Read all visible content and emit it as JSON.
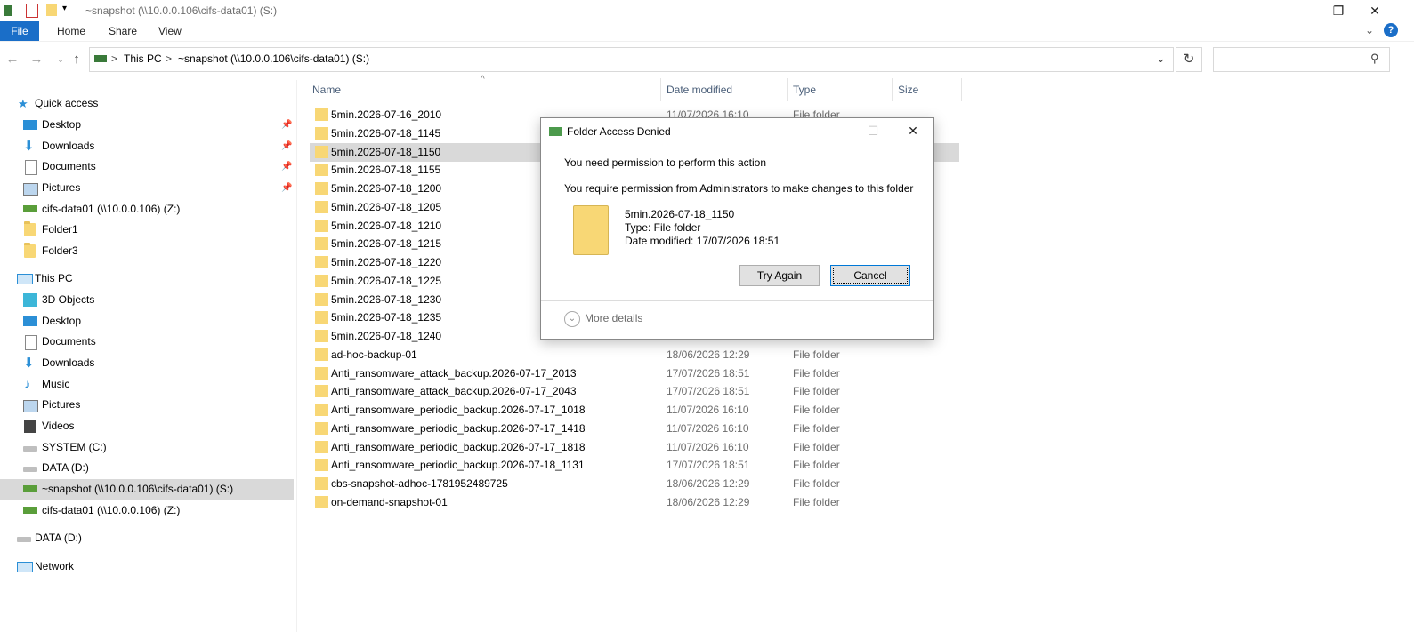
{
  "window": {
    "title": "~snapshot (\\\\10.0.0.106\\cifs-data01) (S:)",
    "minimize_glyph": "—",
    "restore_glyph": "❐",
    "close_glyph": "✕"
  },
  "ribbon": {
    "file": "File",
    "tabs": [
      "Home",
      "Share",
      "View"
    ]
  },
  "address": {
    "crumbs": [
      "This PC",
      "~snapshot (\\\\10.0.0.106\\cifs-data01) (S:)"
    ],
    "separator": ">",
    "search_placeholder": ""
  },
  "sidebar": {
    "items": [
      {
        "label": "Quick access",
        "icon": "star-icon"
      },
      {
        "label": "Desktop",
        "icon": "desktop-icon",
        "pinned": true
      },
      {
        "label": "Downloads",
        "icon": "download-icon",
        "pinned": true
      },
      {
        "label": "Documents",
        "icon": "documents-icon",
        "pinned": true
      },
      {
        "label": "Pictures",
        "icon": "pictures-icon",
        "pinned": true
      },
      {
        "label": "cifs-data01 (\\\\10.0.0.106) (Z:)",
        "icon": "network-drive-icon"
      },
      {
        "label": "Folder1",
        "icon": "folder-icon"
      },
      {
        "label": "Folder3",
        "icon": "folder-icon"
      },
      {
        "label": "This PC",
        "icon": "computer-icon"
      },
      {
        "label": "3D Objects",
        "icon": "3d-objects-icon"
      },
      {
        "label": "Desktop",
        "icon": "desktop-icon"
      },
      {
        "label": "Documents",
        "icon": "documents-icon"
      },
      {
        "label": "Downloads",
        "icon": "download-icon"
      },
      {
        "label": "Music",
        "icon": "music-icon"
      },
      {
        "label": "Pictures",
        "icon": "pictures-icon"
      },
      {
        "label": "Videos",
        "icon": "videos-icon"
      },
      {
        "label": "SYSTEM (C:)",
        "icon": "drive-icon"
      },
      {
        "label": "DATA (D:)",
        "icon": "drive-icon"
      },
      {
        "label": "~snapshot (\\\\10.0.0.106\\cifs-data01) (S:)",
        "icon": "network-drive-icon",
        "selected": true
      },
      {
        "label": "cifs-data01 (\\\\10.0.0.106) (Z:)",
        "icon": "network-drive-icon"
      },
      {
        "label": "DATA (D:)",
        "icon": "drive-icon"
      },
      {
        "label": "Network",
        "icon": "network-icon"
      }
    ]
  },
  "columns": {
    "name": "Name",
    "date": "Date modified",
    "type": "Type",
    "size": "Size"
  },
  "files": [
    {
      "name": "5min.2026-07-16_2010",
      "date": "11/07/2026 16:10",
      "type": "File folder"
    },
    {
      "name": "5min.2026-07-18_1145",
      "date": "",
      "type": ""
    },
    {
      "name": "5min.2026-07-18_1150",
      "date": "",
      "type": "",
      "selected": true
    },
    {
      "name": "5min.2026-07-18_1155",
      "date": "",
      "type": ""
    },
    {
      "name": "5min.2026-07-18_1200",
      "date": "",
      "type": ""
    },
    {
      "name": "5min.2026-07-18_1205",
      "date": "",
      "type": ""
    },
    {
      "name": "5min.2026-07-18_1210",
      "date": "",
      "type": ""
    },
    {
      "name": "5min.2026-07-18_1215",
      "date": "",
      "type": ""
    },
    {
      "name": "5min.2026-07-18_1220",
      "date": "",
      "type": ""
    },
    {
      "name": "5min.2026-07-18_1225",
      "date": "",
      "type": ""
    },
    {
      "name": "5min.2026-07-18_1230",
      "date": "",
      "type": ""
    },
    {
      "name": "5min.2026-07-18_1235",
      "date": "",
      "type": ""
    },
    {
      "name": "5min.2026-07-18_1240",
      "date": "",
      "type": ""
    },
    {
      "name": "ad-hoc-backup-01",
      "date": "18/06/2026 12:29",
      "type": "File folder"
    },
    {
      "name": "Anti_ransomware_attack_backup.2026-07-17_2013",
      "date": "17/07/2026 18:51",
      "type": "File folder"
    },
    {
      "name": "Anti_ransomware_attack_backup.2026-07-17_2043",
      "date": "17/07/2026 18:51",
      "type": "File folder"
    },
    {
      "name": "Anti_ransomware_periodic_backup.2026-07-17_1018",
      "date": "11/07/2026 16:10",
      "type": "File folder"
    },
    {
      "name": "Anti_ransomware_periodic_backup.2026-07-17_1418",
      "date": "11/07/2026 16:10",
      "type": "File folder"
    },
    {
      "name": "Anti_ransomware_periodic_backup.2026-07-17_1818",
      "date": "11/07/2026 16:10",
      "type": "File folder"
    },
    {
      "name": "Anti_ransomware_periodic_backup.2026-07-18_1131",
      "date": "17/07/2026 18:51",
      "type": "File folder"
    },
    {
      "name": "cbs-snapshot-adhoc-1781952489725",
      "date": "18/06/2026 12:29",
      "type": "File folder"
    },
    {
      "name": "on-demand-snapshot-01",
      "date": "18/06/2026 12:29",
      "type": "File folder"
    }
  ],
  "dialog": {
    "title": "Folder Access Denied",
    "heading": "You need permission to perform this action",
    "message": "You require permission from Administrators to make changes to this folder",
    "item_name": "5min.2026-07-18_1150",
    "item_type": "Type: File folder",
    "item_date": "Date modified: 17/07/2026 18:51",
    "try_again": "Try Again",
    "cancel": "Cancel",
    "more_details": "More details"
  },
  "colors": {
    "accent": "#1a6ec8",
    "selection": "#d9d9d9",
    "folder": "#f8d775"
  }
}
